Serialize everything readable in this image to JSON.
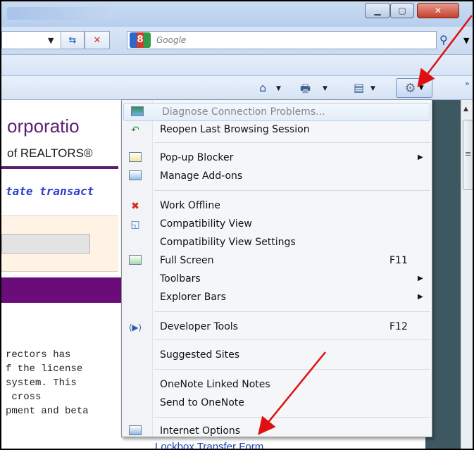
{
  "browser": {
    "search_placeholder": "Google",
    "google_logo_text": "8"
  },
  "page": {
    "corporation_fragment": "orporatio",
    "realtors_fragment": "of REALTORS®",
    "tagline_fragment": "tate transact",
    "body_lines": [
      "rectors has",
      "f the license",
      "system. This",
      " cross",
      "pment and beta"
    ],
    "lockbox_fragment": "Lockbox Transfer Form"
  },
  "tools_menu": {
    "items": [
      {
        "label": "Diagnose Connection Problems...",
        "shortcut": "",
        "submenu": false,
        "icon": "network-diagnose-icon",
        "highlighted": true
      },
      {
        "label": "Reopen Last Browsing Session",
        "shortcut": "",
        "submenu": false,
        "icon": "reopen-session-icon"
      },
      {
        "label": "Pop-up Blocker",
        "shortcut": "",
        "submenu": true,
        "icon": "popup-blocker-icon"
      },
      {
        "label": "Manage Add-ons",
        "shortcut": "",
        "submenu": false,
        "icon": "addons-icon"
      },
      {
        "label": "Work Offline",
        "shortcut": "",
        "submenu": false,
        "icon": "work-offline-icon"
      },
      {
        "label": "Compatibility View",
        "shortcut": "",
        "submenu": false,
        "icon": "compatibility-view-icon"
      },
      {
        "label": "Compatibility View Settings",
        "shortcut": "",
        "submenu": false,
        "icon": ""
      },
      {
        "label": "Full Screen",
        "shortcut": "F11",
        "submenu": false,
        "icon": "full-screen-icon"
      },
      {
        "label": "Toolbars",
        "shortcut": "",
        "submenu": true,
        "icon": ""
      },
      {
        "label": "Explorer Bars",
        "shortcut": "",
        "submenu": true,
        "icon": ""
      },
      {
        "label": "Developer Tools",
        "shortcut": "F12",
        "submenu": false,
        "icon": "developer-tools-icon"
      },
      {
        "label": "Suggested Sites",
        "shortcut": "",
        "submenu": false,
        "icon": ""
      },
      {
        "label": "OneNote Linked Notes",
        "shortcut": "",
        "submenu": false,
        "icon": ""
      },
      {
        "label": "Send to OneNote",
        "shortcut": "",
        "submenu": false,
        "icon": ""
      },
      {
        "label": "Internet Options",
        "shortcut": "",
        "submenu": false,
        "icon": "internet-options-icon"
      }
    ]
  },
  "colors": {
    "annotation_arrow": "#e01010",
    "page_accent": "#6a0c79",
    "menu_background": "#f4f6f8"
  }
}
